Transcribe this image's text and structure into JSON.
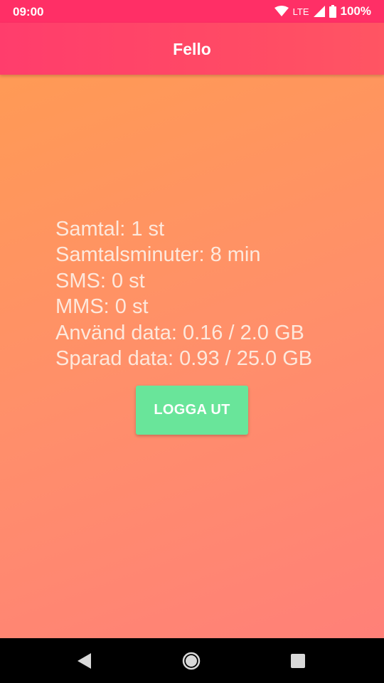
{
  "status_bar": {
    "time": "09:00",
    "network": "LTE",
    "battery": "100%",
    "icons": [
      "wifi-icon",
      "signal-icon",
      "battery-icon"
    ]
  },
  "app_bar": {
    "title": "Fello",
    "color": "#ff3d6c"
  },
  "stats": {
    "calls": "Samtal: 1 st",
    "call_minutes": "Samtalsminuter: 8 min",
    "sms": "SMS: 0 st",
    "mms": "MMS: 0 st",
    "used_data": "Använd data: 0.16 / 2.0 GB",
    "saved_data": "Sparad data: 0.93 / 25.0 GB"
  },
  "logout_button": {
    "label": "LOGGA UT",
    "color": "#69e59a"
  },
  "nav_bar": {
    "icons": [
      "back-icon",
      "home-icon",
      "recents-icon"
    ]
  }
}
